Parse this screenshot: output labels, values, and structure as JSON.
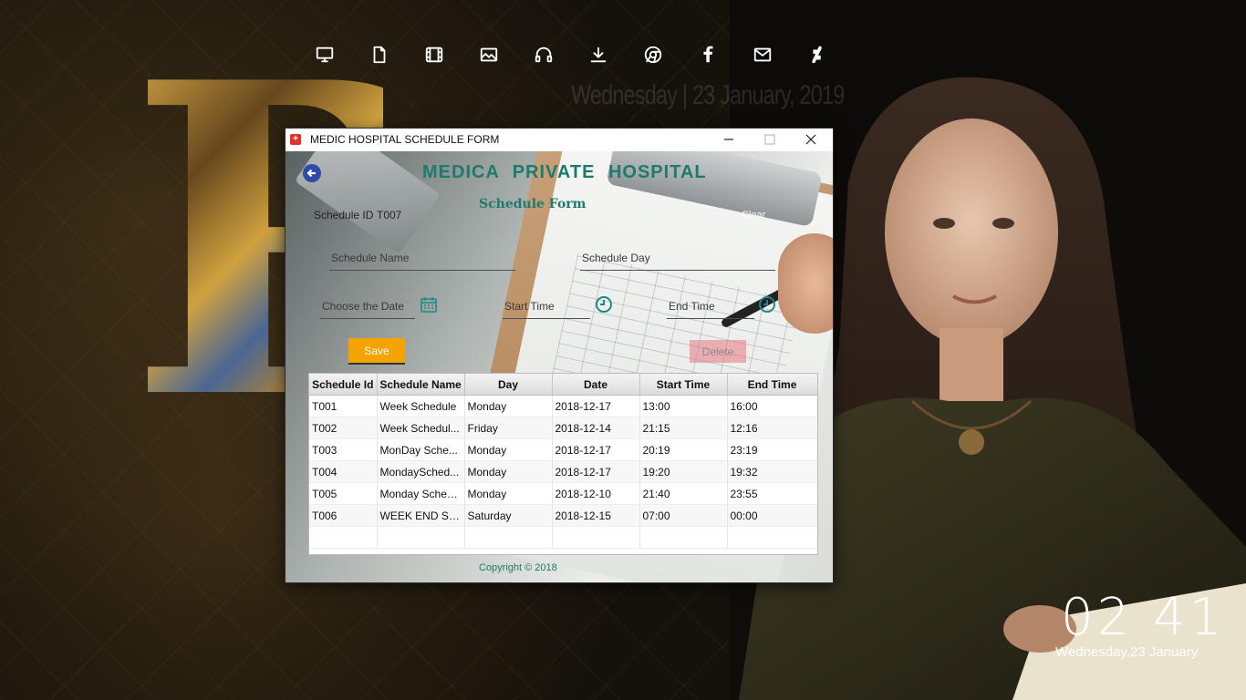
{
  "desktop": {
    "faded_date": "Wednesday | 23 January, 2019",
    "clock_time": "02 41",
    "clock_date": "Wednesday,23 January",
    "icons": [
      "monitor-icon",
      "document-icon",
      "film-icon",
      "image-icon",
      "headphones-icon",
      "download-icon",
      "chrome-icon",
      "facebook-icon",
      "mail-icon",
      "deviantart-icon"
    ]
  },
  "window": {
    "title": "MEDIC HOSPITAL  SCHEDULE FORM",
    "hospital_title": "MEDICA  PRIVATE  HOSPITAL",
    "form_title": "Schedule Form",
    "schedule_id_label": "Schedule ID",
    "schedule_id_value": "T007",
    "clear_label": "Clear",
    "fields": {
      "schedule_name_placeholder": "Schedule Name",
      "schedule_day_placeholder": "Schedule Day",
      "choose_date_placeholder": "Choose the Date",
      "start_time_placeholder": "Start Time",
      "end_time_placeholder": "End Time"
    },
    "save_label": "Save",
    "delete_label": "Delete",
    "copyright": "Copyright © 2018"
  },
  "table": {
    "columns": [
      "Schedule Id",
      "Schedule Name",
      "Day",
      "Date",
      "Start Time",
      "End Time"
    ],
    "rows": [
      [
        "T001",
        "Week Schedule",
        "Monday",
        "2018-12-17",
        "13:00",
        "16:00"
      ],
      [
        "T002",
        "Week Schedul...",
        "Friday",
        "2018-12-14",
        "21:15",
        "12:16"
      ],
      [
        "T003",
        "MonDay Sche...",
        "Monday",
        "2018-12-17",
        "20:19",
        "23:19"
      ],
      [
        "T004",
        "MondaySched...",
        "Monday",
        "2018-12-17",
        "19:20",
        "19:32"
      ],
      [
        "T005",
        "Monday Sched...",
        "Monday",
        "2018-12-10",
        "21:40",
        "23:55"
      ],
      [
        "T006",
        "WEEK END Sch...",
        "Saturday",
        "2018-12-15",
        "07:00",
        "00:00"
      ]
    ]
  },
  "colors": {
    "accent_teal": "#1d7a6c",
    "save_orange": "#f5a300",
    "back_blue": "#2f4aa8"
  }
}
